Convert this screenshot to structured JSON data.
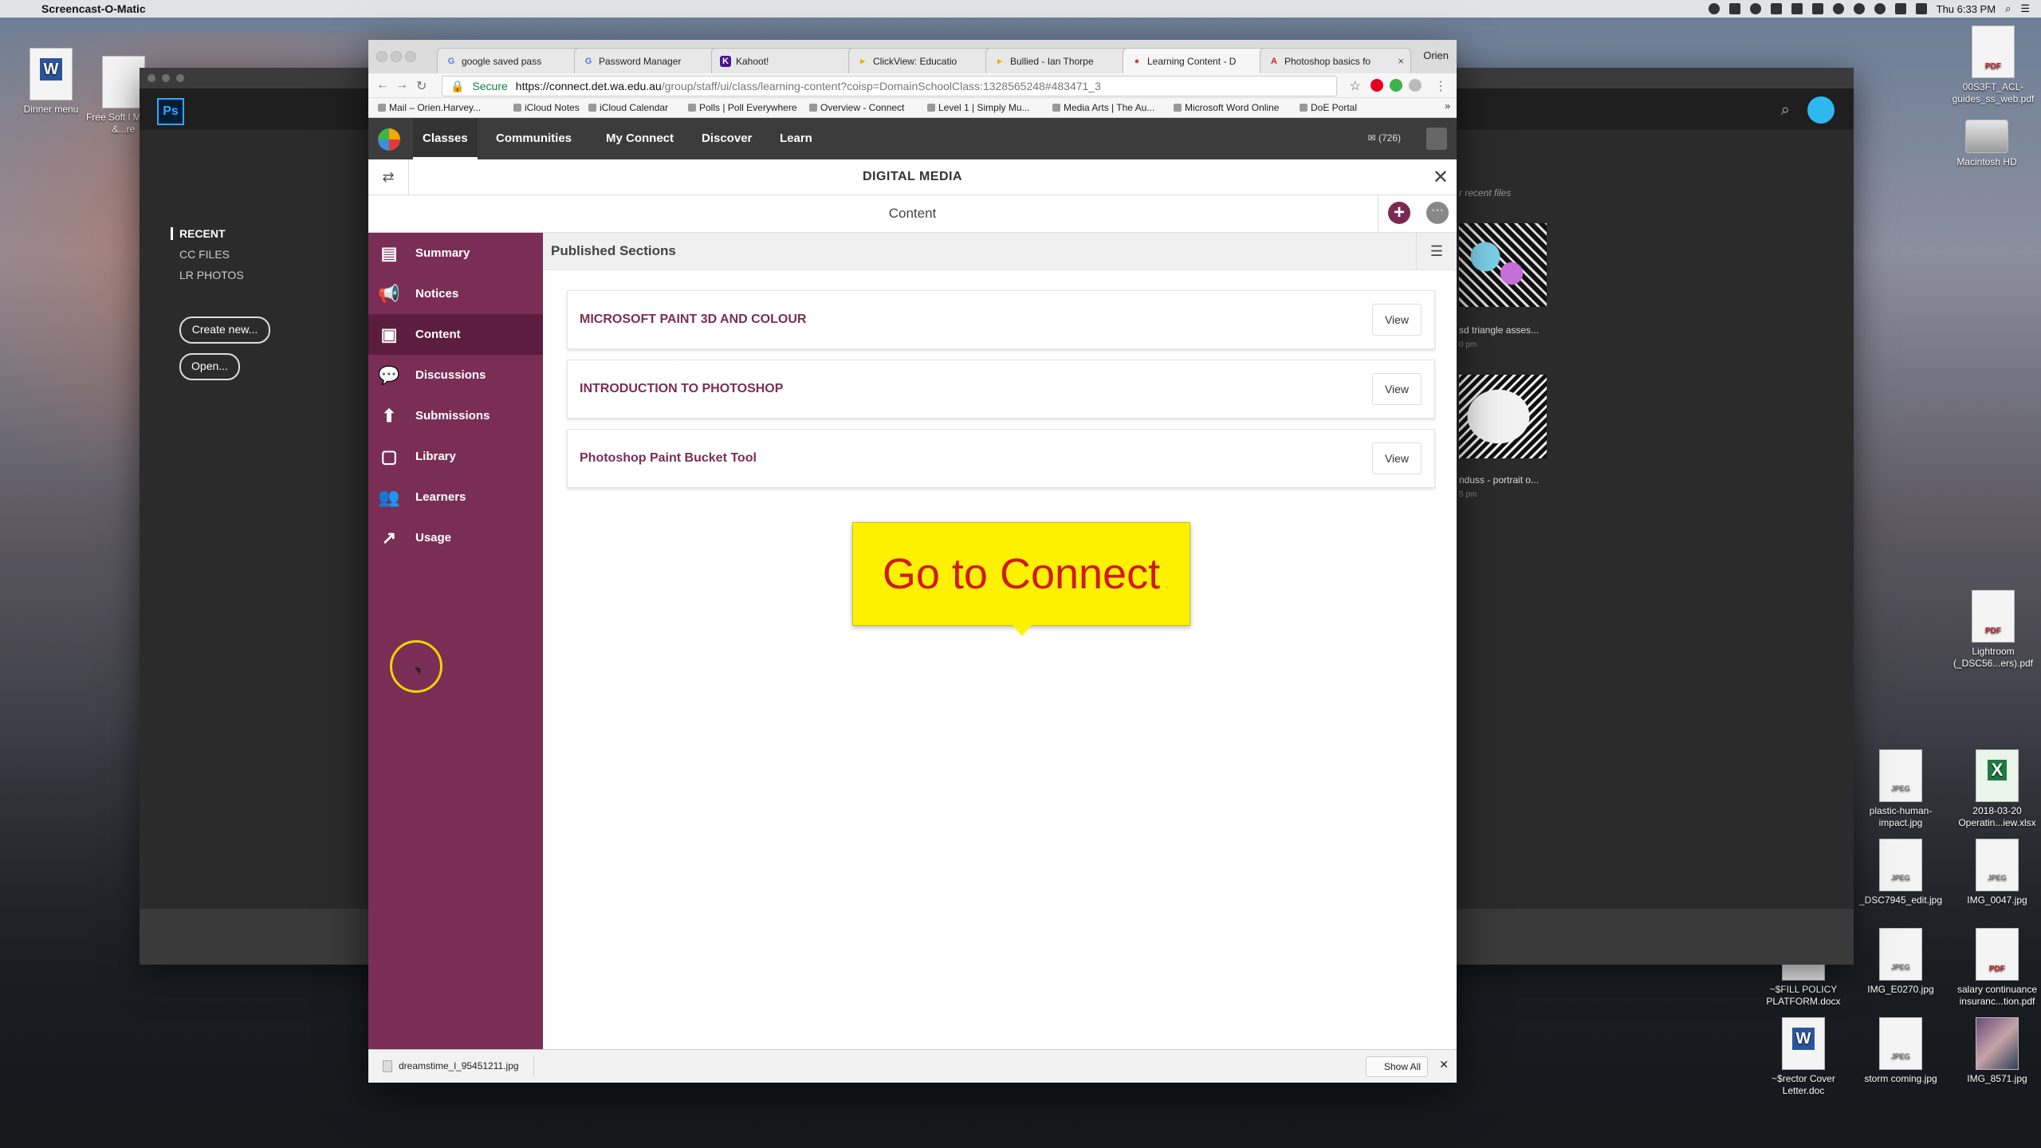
{
  "os": {
    "app_name": "Screencast-O-Matic",
    "clock": "Thu 6:33 PM"
  },
  "desktop_icons": [
    {
      "label": "Dinner menu",
      "type": "doc"
    },
    {
      "label": "Free Soft l Mobile &...re",
      "type": "zip"
    },
    {
      "label": "00S3FT_ACL-guides_ss_web.pdf",
      "type": "pdf"
    },
    {
      "label": "Macintosh HD",
      "type": "hd"
    },
    {
      "label": "Lightroom (_DSC56...ers).pdf",
      "type": "pdf"
    },
    {
      "label": "plastic-human-impact.jpg",
      "type": "jpg"
    },
    {
      "label": "2018-03-20 Operatin...iew.xlsx",
      "type": "xls"
    },
    {
      "label": "_DSC7945_edit.jpg",
      "type": "jpg"
    },
    {
      "label": "IMG_0047.jpg",
      "type": "jpg"
    },
    {
      "label": "~$FILL POLICY PLATFORM.docx",
      "type": "doc"
    },
    {
      "label": "IMG_E0270.jpg",
      "type": "jpg"
    },
    {
      "label": "salary continuance insuranc...tion.pdf",
      "type": "pdf"
    },
    {
      "label": "~$rector Cover Letter.doc",
      "type": "doc"
    },
    {
      "label": "storm coming.jpg",
      "type": "jpg"
    },
    {
      "label": "IMG_8571.jpg",
      "type": "img"
    }
  ],
  "photoshop": {
    "logo": "Ps",
    "sidebar": [
      "RECENT",
      "CC FILES",
      "LR PHOTOS"
    ],
    "buttons": [
      "Create new...",
      "Open..."
    ],
    "recent_label": "r recent files",
    "thumbs": [
      {
        "label": "sd triangle asses...",
        "time": "0 pm"
      },
      {
        "label": "nduss - portrait o...",
        "time": "5 pm"
      }
    ]
  },
  "browser": {
    "tabs": [
      {
        "label": "google saved pass",
        "fav_color": "#4285f4",
        "fav": "G"
      },
      {
        "label": "Password Manager",
        "fav_color": "#4285f4",
        "fav": "G"
      },
      {
        "label": "Kahoot!",
        "fav_color": "#46178f",
        "fav": "K"
      },
      {
        "label": "ClickView: Educatio",
        "fav_color": "#f7a600",
        "fav": "▸"
      },
      {
        "label": "Bullied - Ian Thorpe",
        "fav_color": "#f7a600",
        "fav": "▸"
      },
      {
        "label": "Learning Content - D",
        "fav_color": "#e03a3a",
        "fav": "●"
      },
      {
        "label": "Photoshop basics fo",
        "fav_color": "#e31b23",
        "fav": "A"
      }
    ],
    "profile": "Orien",
    "secure_label": "Secure",
    "url_host": "https://connect.det.wa.edu.au",
    "url_path": "/group/staff/ui/class/learning-content?coisp=DomainSchoolClass:1328565248#483471_3",
    "bookmarks": [
      "Mail – Orien.Harvey...",
      "iCloud Notes",
      "iCloud Calendar",
      "Polls | Poll Everywhere",
      "Overview - Connect",
      "Level 1 | Simply Mu...",
      "Media Arts | The Au...",
      "Microsoft Word Online",
      "DoE Portal"
    ],
    "more_bookmarks": "»"
  },
  "connect": {
    "nav": [
      "Classes",
      "Communities",
      "My Connect",
      "Discover",
      "Learn"
    ],
    "mail_count": "(726)",
    "class_title": "DIGITAL MEDIA",
    "section_title": "Content",
    "sidebar": [
      {
        "label": "Summary",
        "icon": "summary-icon",
        "glyph": "▤"
      },
      {
        "label": "Notices",
        "icon": "megaphone-icon",
        "glyph": "📢"
      },
      {
        "label": "Content",
        "icon": "content-icon",
        "glyph": "▣"
      },
      {
        "label": "Discussions",
        "icon": "discussions-icon",
        "glyph": "💬"
      },
      {
        "label": "Submissions",
        "icon": "submissions-icon",
        "glyph": "⬆"
      },
      {
        "label": "Library",
        "icon": "library-icon",
        "glyph": "▢"
      },
      {
        "label": "Learners",
        "icon": "learners-icon",
        "glyph": "👥"
      },
      {
        "label": "Usage",
        "icon": "usage-icon",
        "glyph": "↗"
      }
    ],
    "active_sidebar": "Content",
    "published_heading": "Published Sections",
    "sections": [
      {
        "title": "MICROSOFT PAINT 3D AND COLOUR",
        "action": "View"
      },
      {
        "title": "INTRODUCTION TO PHOTOSHOP",
        "action": "View"
      },
      {
        "title": "Photoshop Paint Bucket Tool",
        "action": "View"
      }
    ],
    "callout": "Go to Connect"
  },
  "downloads": {
    "file": "dreamstime_l_95451211.jpg",
    "show_all": "Show All"
  }
}
